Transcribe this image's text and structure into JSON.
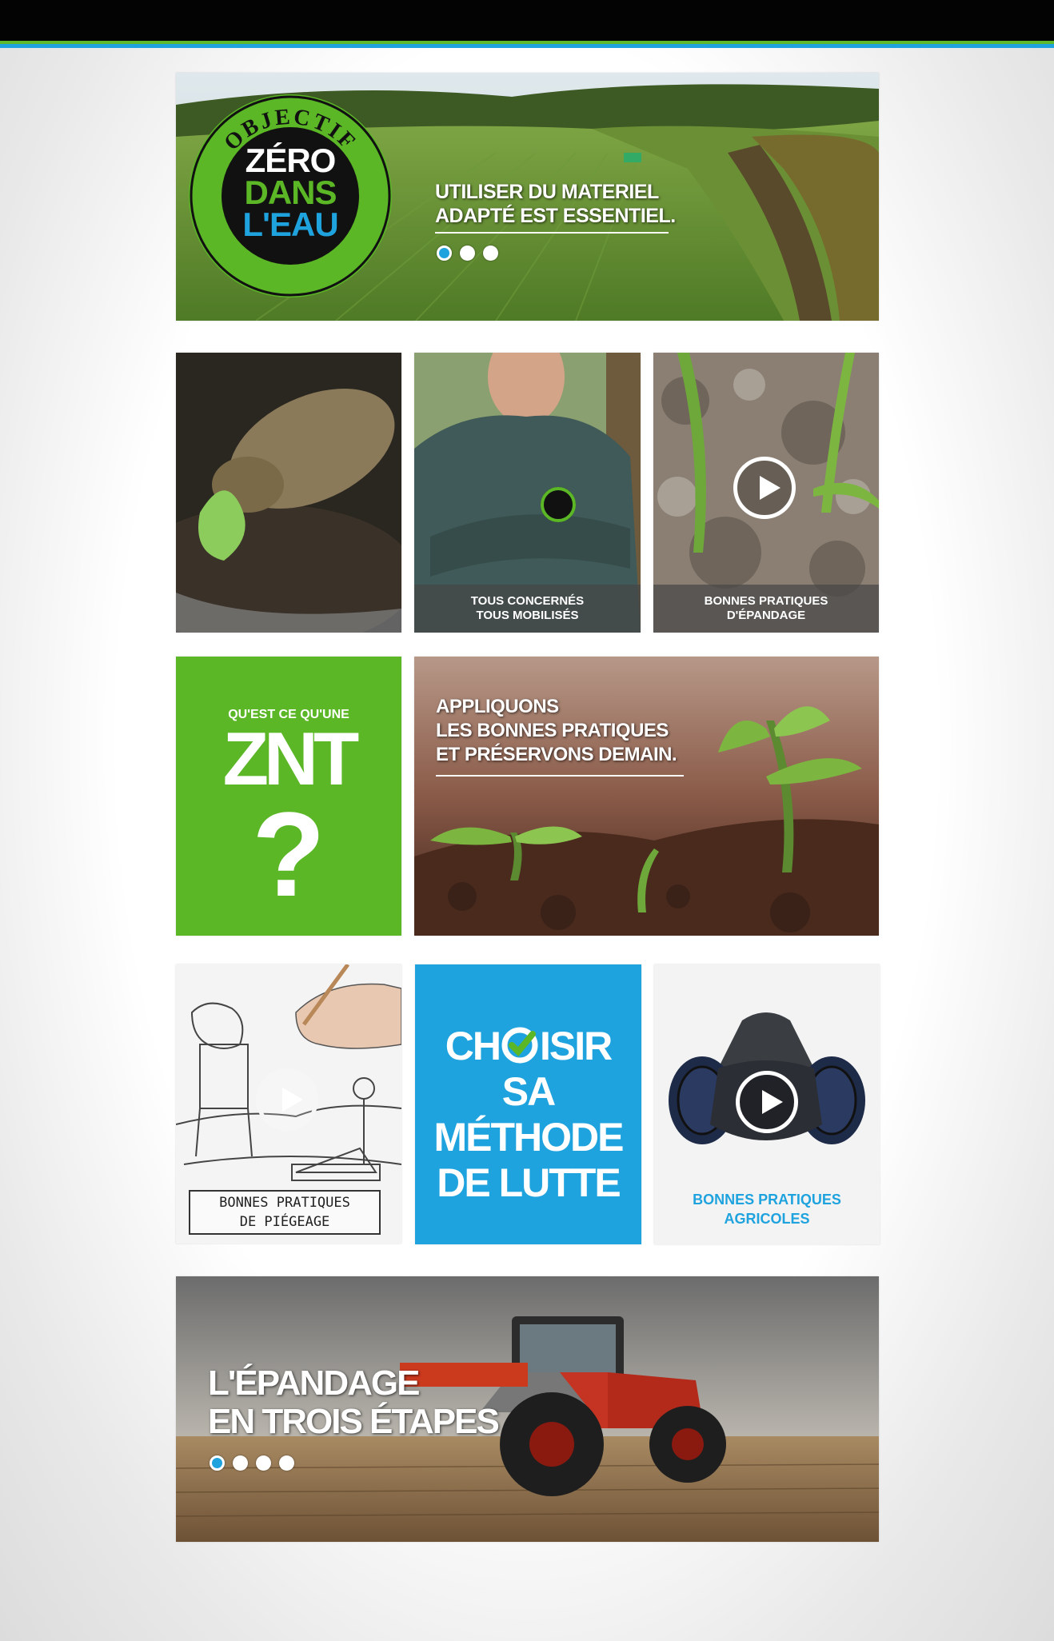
{
  "hero": {
    "badge_top": "OBJECTIF",
    "badge_bottom": "OBJECTIF",
    "badge_line1": "ZÉRO",
    "badge_line2": "DANS",
    "badge_line3": "L'EAU",
    "text_line1": "UTILISER DU MATERIEL",
    "text_line2": "ADAPTÉ EST ESSENTIEL.",
    "slides": 3,
    "active_slide": 1
  },
  "row1": {
    "tile2_line1": "TOUS CONCERNÉS",
    "tile2_line2": "TOUS MOBILISÉS",
    "tile3_line1": "BONNES PRATIQUES",
    "tile3_line2": "D'ÉPANDAGE"
  },
  "row2": {
    "znt_question": "QU'EST CE QU'UNE",
    "znt_title": "ZNT",
    "znt_mark": "?",
    "banner_line1": "APPLIQUONS",
    "banner_line2": "LES BONNES PRATIQUES",
    "banner_line3": "ET PRÉSERVONS DEMAIN."
  },
  "row3": {
    "piegeage_line1": "BONNES PRATIQUES",
    "piegeage_line2": "DE PIÉGEAGE",
    "choisir_line1_a": "CH",
    "choisir_line1_b": "ISIR",
    "choisir_line2": "SA",
    "choisir_line3": "MÉTHODE",
    "choisir_line4": "DE LUTTE",
    "agricoles_line1": "BONNES PRATIQUES",
    "agricoles_line2": "AGRICOLES"
  },
  "footer_banner": {
    "line1": "L'ÉPANDAGE",
    "line2": "EN TROIS ÉTAPES",
    "slides": 4,
    "active_slide": 1
  },
  "colors": {
    "green": "#5bb726",
    "blue": "#1fa3de",
    "black": "#030303"
  }
}
